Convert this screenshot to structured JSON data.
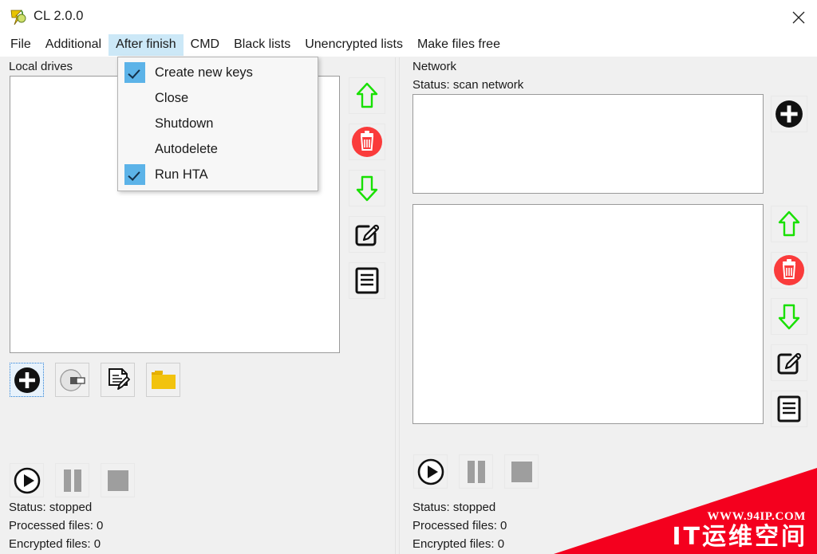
{
  "window": {
    "title": "CL 2.0.0",
    "app_icon": "7zip-like-app-icon",
    "close_icon": "close-icon"
  },
  "menubar": {
    "items": [
      {
        "label": "File",
        "active": false
      },
      {
        "label": "Additional",
        "active": false
      },
      {
        "label": "After finish",
        "active": true
      },
      {
        "label": "CMD",
        "active": false
      },
      {
        "label": "Black lists",
        "active": false
      },
      {
        "label": "Unencrypted lists",
        "active": false
      },
      {
        "label": "Make files free",
        "active": false
      }
    ]
  },
  "dropdown": {
    "owner": "After finish",
    "items": [
      {
        "label": "Create new keys",
        "checked": true
      },
      {
        "label": "Close",
        "checked": false
      },
      {
        "label": "Shutdown",
        "checked": false
      },
      {
        "label": "Autodelete",
        "checked": false
      },
      {
        "label": "Run HTA",
        "checked": true
      }
    ]
  },
  "left_panel": {
    "label": "Local drives",
    "list_items": [],
    "source_buttons": [
      {
        "icon": "add-circle-icon",
        "focused": true
      },
      {
        "icon": "disc-drive-icon",
        "focused": false
      },
      {
        "icon": "document-edit-icon",
        "focused": false
      },
      {
        "icon": "folder-icon",
        "focused": false
      }
    ],
    "side_buttons": [
      {
        "icon": "arrow-up-icon"
      },
      {
        "icon": "delete-trash-icon"
      },
      {
        "icon": "arrow-down-icon"
      },
      {
        "icon": "edit-pencil-icon"
      },
      {
        "icon": "list-lines-icon"
      }
    ],
    "transport": [
      {
        "icon": "play-icon"
      },
      {
        "icon": "pause-icon"
      },
      {
        "icon": "stop-icon"
      }
    ],
    "status": {
      "status": "Status: stopped",
      "processed": "Processed files: 0",
      "encrypted": "Encrypted files: 0"
    }
  },
  "right_panel": {
    "label": "Network",
    "status_label": "Status: scan network",
    "top_list_items": [],
    "bottom_list_items": [],
    "add_button": {
      "icon": "add-circle-icon"
    },
    "side_buttons": [
      {
        "icon": "arrow-up-icon"
      },
      {
        "icon": "delete-trash-icon"
      },
      {
        "icon": "arrow-down-icon"
      },
      {
        "icon": "edit-pencil-icon"
      },
      {
        "icon": "list-lines-icon"
      }
    ],
    "transport": [
      {
        "icon": "play-icon"
      },
      {
        "icon": "pause-icon"
      },
      {
        "icon": "stop-icon"
      }
    ],
    "status": {
      "status": "Status: stopped",
      "processed": "Processed files: 0",
      "encrypted": "Encrypted files: 0"
    }
  },
  "watermark": {
    "url": "WWW.94IP.COM",
    "name": "IT运维空间",
    "color": "#f4001e"
  },
  "colors": {
    "menu_highlight": "#cce8f7",
    "check_blue": "#5cb3e8",
    "arrow_green": "#18e000",
    "trash_red": "#fa3b3b",
    "folder_yellow": "#f5c518",
    "window_bg": "#f0f0f0"
  }
}
